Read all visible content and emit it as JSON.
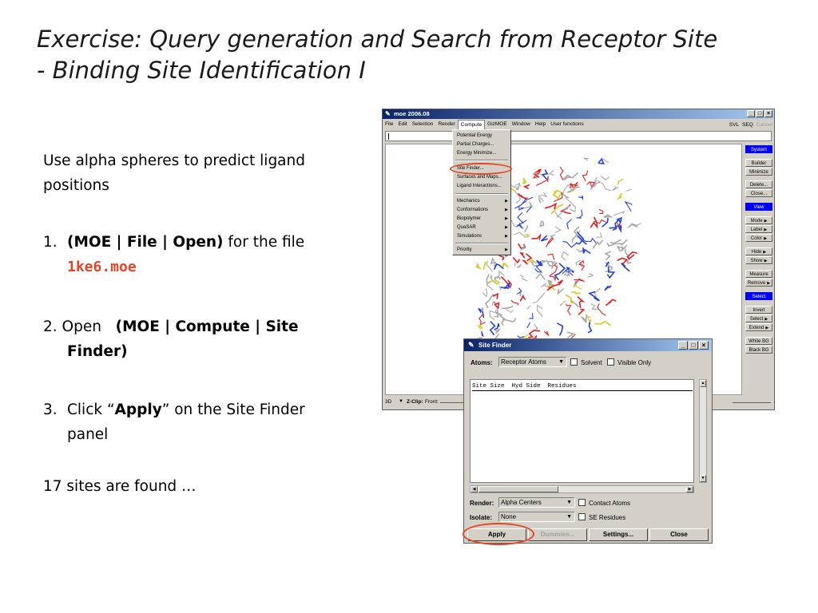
{
  "slide": {
    "title_line1": "Exercise: Query generation and Search from Receptor Site",
    "title_line2": "- Binding Site Identification I",
    "intro_line1": "Use alpha spheres to predict ligand",
    "intro_line2": "positions",
    "step1_num": "1.",
    "step1_bold": "(MOE | File | Open)",
    "step1_rest": " for the file",
    "step1_file": "1ke6.moe",
    "step2_num": "2. Open",
    "step2_bold_line1": "(MOE | Compute | Site",
    "step2_bold_line2": "Finder)",
    "step3_num": "3.",
    "step3_pre": "Click “",
    "step3_bold": "Apply",
    "step3_post": "” on the Site Finder",
    "step3_line2": "panel",
    "result": "17 sites are found …"
  },
  "moe_window": {
    "title": "moe 2006.08",
    "menu": [
      "File",
      "Edit",
      "Selection",
      "Render",
      "Compute",
      "GizMOE",
      "Window",
      "Help",
      "User functions"
    ],
    "active_menu": "Compute",
    "menu_right": [
      "SVL",
      "SEQ"
    ],
    "menu_right_disabled": "Cancel",
    "compute_menu": {
      "group1": [
        "Potential Energy",
        "Partial Charges...",
        "Energy Minimize..."
      ],
      "group2": [
        "Site Finder...",
        "Surfaces and Maps...",
        "Ligand Interactions..."
      ],
      "group3": [
        "Mechanics",
        "Conformations",
        "Biopolymer",
        "QuaSAR",
        "Simulations"
      ],
      "group4": [
        "Priority"
      ]
    },
    "side_panel": {
      "system": "System",
      "builder": "Builder",
      "minimize": "Minimize",
      "delete": "Delete...",
      "close": "Close...",
      "view": "View",
      "mode": "Mode",
      "label": "Label",
      "color": "Color",
      "hide": "Hide",
      "show": "Show",
      "measure": "Measure",
      "remove": "Remove",
      "select_header": "Select",
      "invert": "Invert",
      "select": "Select",
      "extend": "Extend",
      "white_bg": "White BG",
      "black_bg": "Black BG"
    },
    "bottom": {
      "mode": "3D",
      "zclip": "Z-Clip:",
      "front": "Front:"
    }
  },
  "site_finder": {
    "title": "Site Finder",
    "atoms_label": "Atoms:",
    "atoms_value": "Receptor Atoms",
    "solvent": "Solvent",
    "visible_only": "Visible Only",
    "list_header": "Site Size  Hyd Side  Residues",
    "render_label": "Render:",
    "render_value": "Alpha Centers",
    "contact_atoms": "Contact Atoms",
    "isolate_label": "Isolate:",
    "isolate_value": "None",
    "se_residues": "SE Residues",
    "buttons": {
      "apply": "Apply",
      "dummies": "Dummies...",
      "settings": "Settings...",
      "close": "Close"
    }
  },
  "colors": {
    "highlight_oval": "#e0471f",
    "file_name": "#e0472a",
    "title_bar": "#0a246a",
    "panel_header": "#0000ff"
  }
}
